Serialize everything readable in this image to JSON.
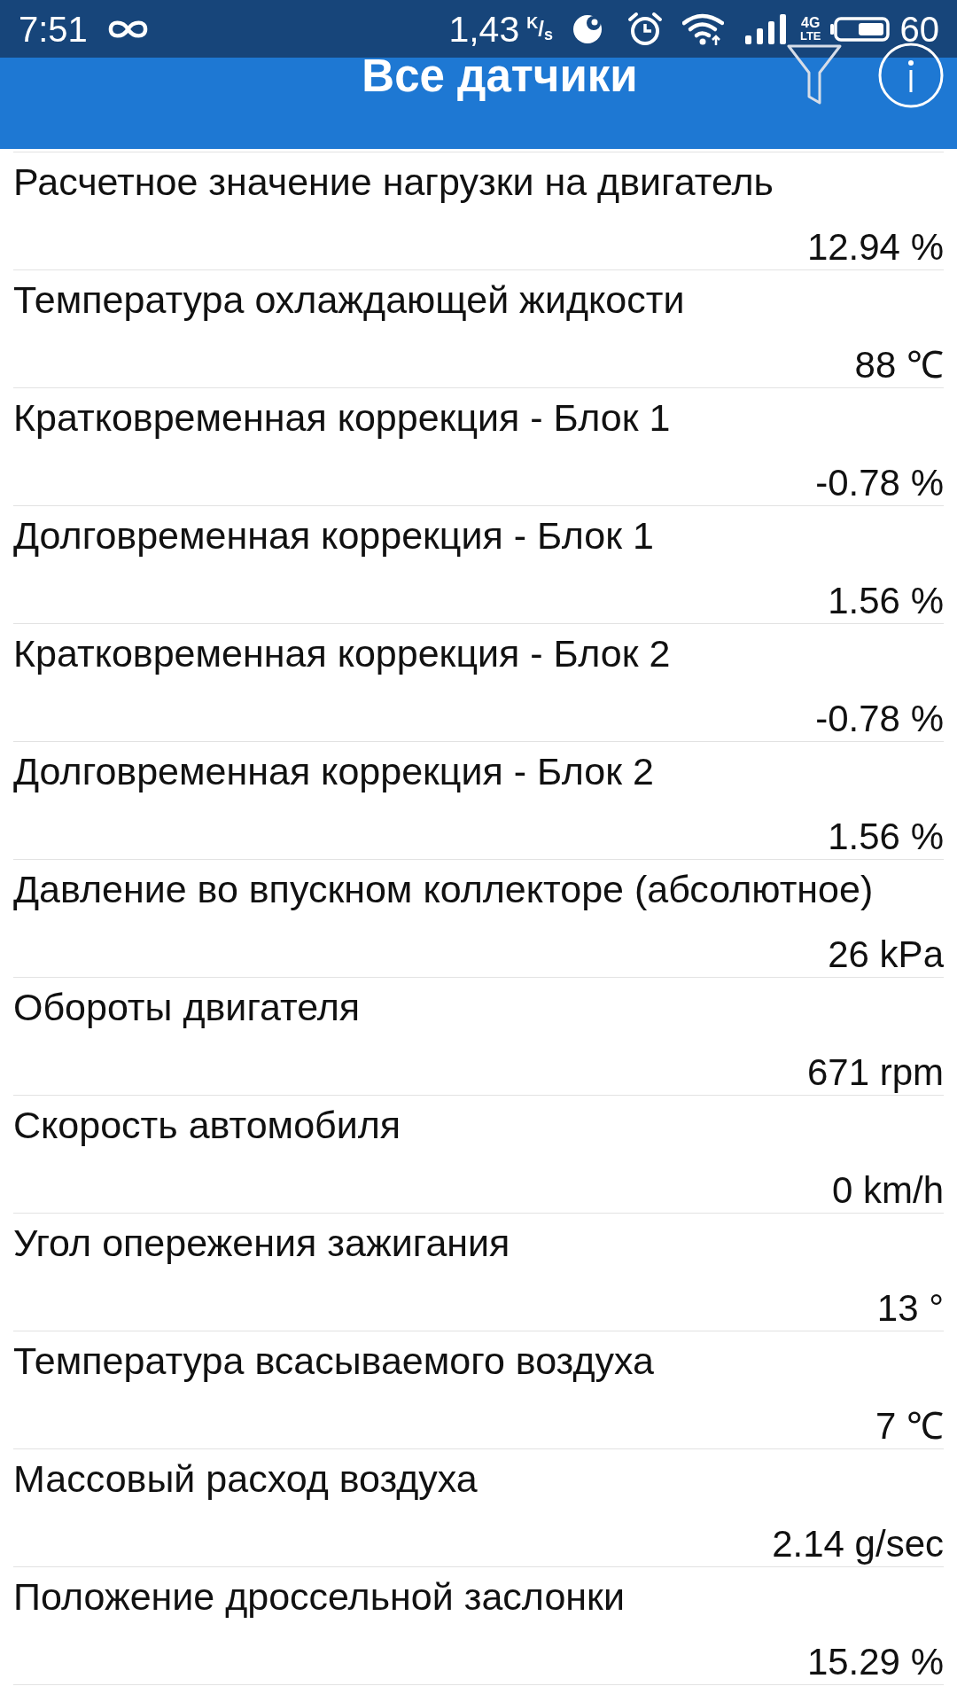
{
  "status_bar": {
    "time": "7:51",
    "speed": "1,43",
    "speed_unit": "$^{K}$/$_{s}$",
    "network_type": "4G",
    "network_sub": "LTE",
    "battery": "60"
  },
  "toolbar": {
    "title": "Все датчики"
  },
  "sensors": [
    {
      "name": "Расчетное значение нагрузки на двигатель",
      "value": "12.94 %"
    },
    {
      "name": "Температура охлаждающей жидкости",
      "value": "88 ℃"
    },
    {
      "name": "Кратковременная коррекция - Блок 1",
      "value": "-0.78 %"
    },
    {
      "name": "Долговременная коррекция - Блок 1",
      "value": "1.56 %"
    },
    {
      "name": "Кратковременная коррекция - Блок 2",
      "value": "-0.78 %"
    },
    {
      "name": "Долговременная коррекция - Блок 2",
      "value": "1.56 %"
    },
    {
      "name": "Давление во впускном коллекторе (абсолютное)",
      "value": "26 kPa"
    },
    {
      "name": "Обороты двигателя",
      "value": "671 rpm"
    },
    {
      "name": "Скорость автомобиля",
      "value": "0 km/h"
    },
    {
      "name": "Угол опережения зажигания",
      "value": "13 °"
    },
    {
      "name": "Температура всасываемого воздуха",
      "value": "7 ℃"
    },
    {
      "name": "Массовый расход воздуха",
      "value": "2.14 g/sec"
    },
    {
      "name": "Положение дроссельной заслонки",
      "value": "15.29 %"
    }
  ]
}
